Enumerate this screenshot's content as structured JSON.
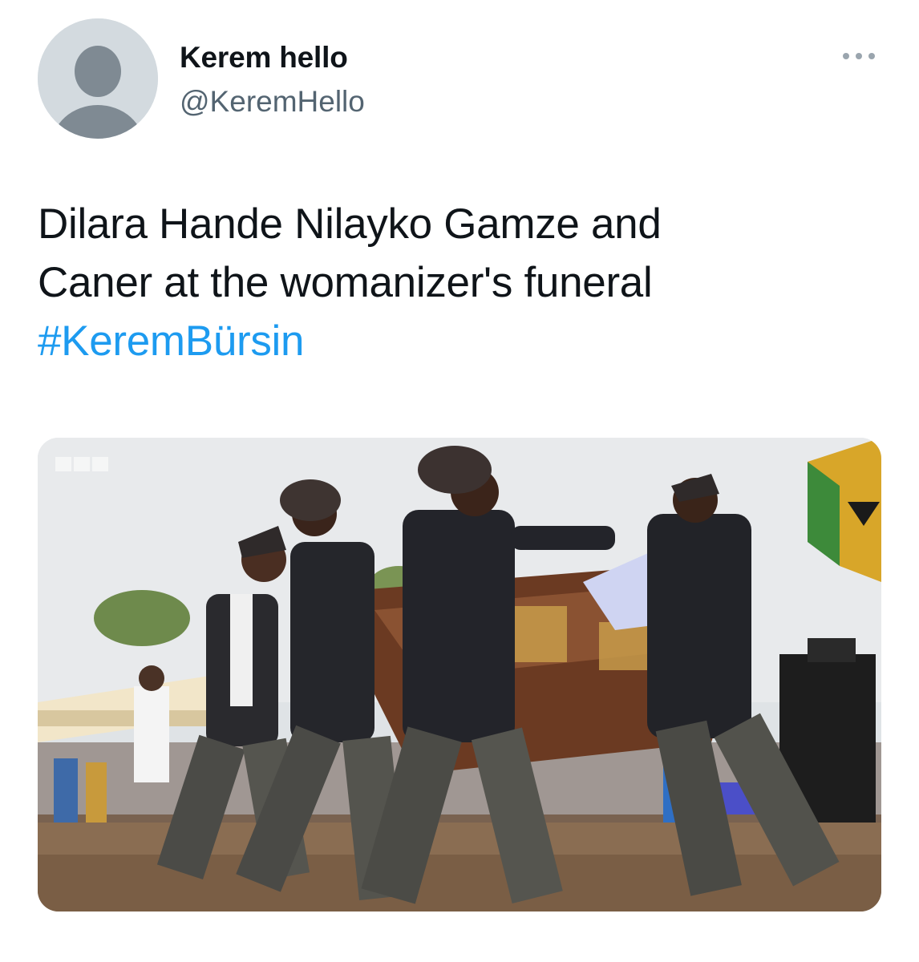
{
  "author": {
    "display_name": "Kerem hello",
    "handle": "@KeremHello",
    "avatar_icon": "default-avatar-icon"
  },
  "menu": {
    "more_icon": "more-options-icon"
  },
  "tweet": {
    "text_line_1": "Dilara Hande Nilayko Gamze and",
    "text_line_2": "Caner at the womanizer's funeral",
    "hashtag": "#KeremBürsin"
  },
  "media": {
    "type": "photo",
    "watermark": "BBC",
    "description_icon": "photo-pallbearers-dancing-with-coffin"
  },
  "colors": {
    "text": "#0f1419",
    "secondary": "#536471",
    "link": "#1d9bf0",
    "avatar_bg": "#d3dadf",
    "avatar_fg": "#8b98a5"
  }
}
